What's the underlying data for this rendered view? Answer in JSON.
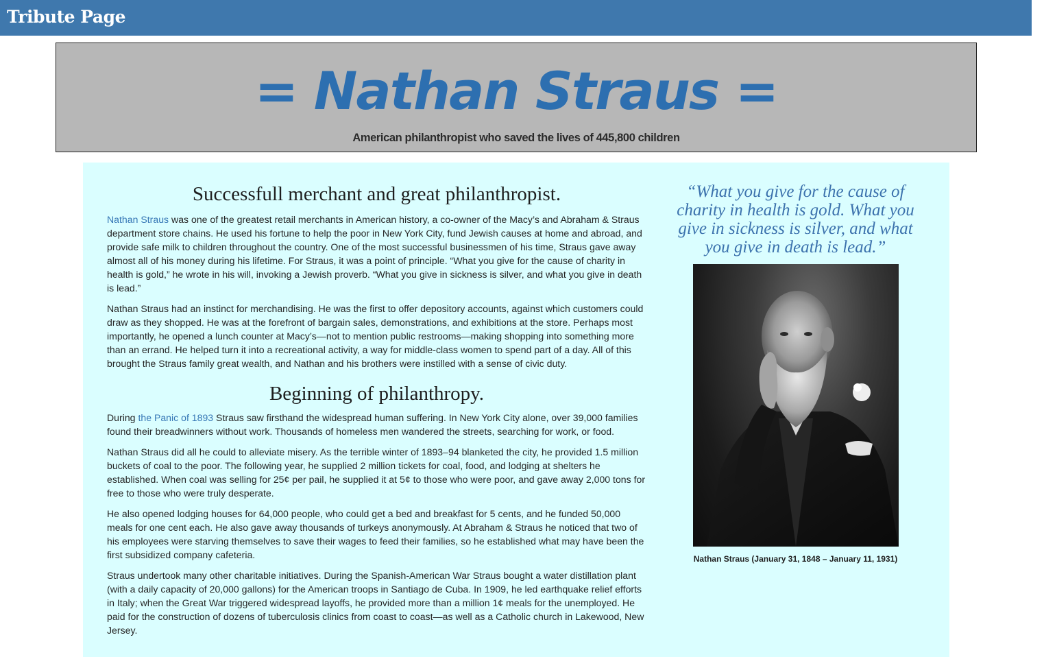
{
  "navbar": {
    "brand": "Tribute Page"
  },
  "hero": {
    "title": "= Nathan Straus =",
    "subtitle": "American philanthropist who saved the lives of 445,800 children"
  },
  "article": {
    "section1": {
      "heading": "Successfull merchant and great philanthropist.",
      "p1_link": "Nathan Straus",
      "p1_text": " was one of the greatest retail merchants in American history, a co-owner of the Macy’s and Abraham & Straus department store chains. He used his fortune to help the poor in New York City, fund Jewish causes at home and abroad, and provide safe milk to children throughout the country. One of the most successful businessmen of his time, Straus gave away almost all of his money during his lifetime. For Straus, it was a point of principle. “What you give for the cause of charity in health is gold,” he wrote in his will, invoking a Jewish proverb. “What you give in sickness is silver, and what you give in death is lead.”",
      "p2": "Nathan Straus had an instinct for merchandising. He was the first to offer depository accounts, against which customers could draw as they shopped. He was at the forefront of bargain sales, demonstrations, and exhibitions at the store. Perhaps most importantly, he opened a lunch counter at Macy’s—not to mention public restrooms—making shopping into something more than an errand. He helped turn it into a recreational activity, a way for middle-class women to spend part of a day. All of this brought the Straus family great wealth, and Nathan and his brothers were instilled with a sense of civic duty."
    },
    "section2": {
      "heading": "Beginning of philanthropy.",
      "p1_prefix": "During ",
      "p1_link": "the Panic of 1893",
      "p1_text": " Straus saw firsthand the widespread human suffering. In New York City alone, over 39,000 families found their breadwinners without work. Thousands of homeless men wandered the streets, searching for work, or food.",
      "p2": "Nathan Straus did all he could to alleviate misery. As the terrible winter of 1893–94 blanketed the city, he provided 1.5 million buckets of coal to the poor. The following year, he supplied 2 million tickets for coal, food, and lodging at shelters he established. When coal was selling for 25¢ per pail, he supplied it at 5¢ to those who were poor, and gave away 2,000 tons for free to those who were truly desperate.",
      "p3": "He also opened lodging houses for 64,000 people, who could get a bed and breakfast for 5 cents, and he funded 50,000 meals for one cent each. He also gave away thousands of turkeys anonymously. At Abraham & Straus he noticed that two of his employees were starving themselves to save their wages to feed their families, so he established what may have been the first subsidized company cafeteria.",
      "p4": "Straus undertook many other charitable initiatives. During the Spanish-American War Straus bought a water distillation plant (with a daily capacity of 20,000 gallons) for the American troops in Santiago de Cuba. In 1909, he led earthquake relief efforts in Italy; when the Great War triggered widespread layoffs, he provided more than a million 1¢ meals for the unemployed. He paid for the construction of dozens of tuberculosis clinics from coast to coast—as well as a Catholic church in Lakewood, New Jersey."
    }
  },
  "sidebar": {
    "quote": "“What you give for the cause of charity in health is gold. What you give in sickness is silver, and what you give in death is lead.”",
    "caption": "Nathan Straus (January 31, 1848 – January 11, 1931)"
  },
  "colors": {
    "navbar": "#3f78ad",
    "hero_background": "#b7b7b7",
    "hero_title": "#2d6fb0",
    "content_background": "#dafeff",
    "link": "#3576b5",
    "quote": "#3c72ad"
  }
}
